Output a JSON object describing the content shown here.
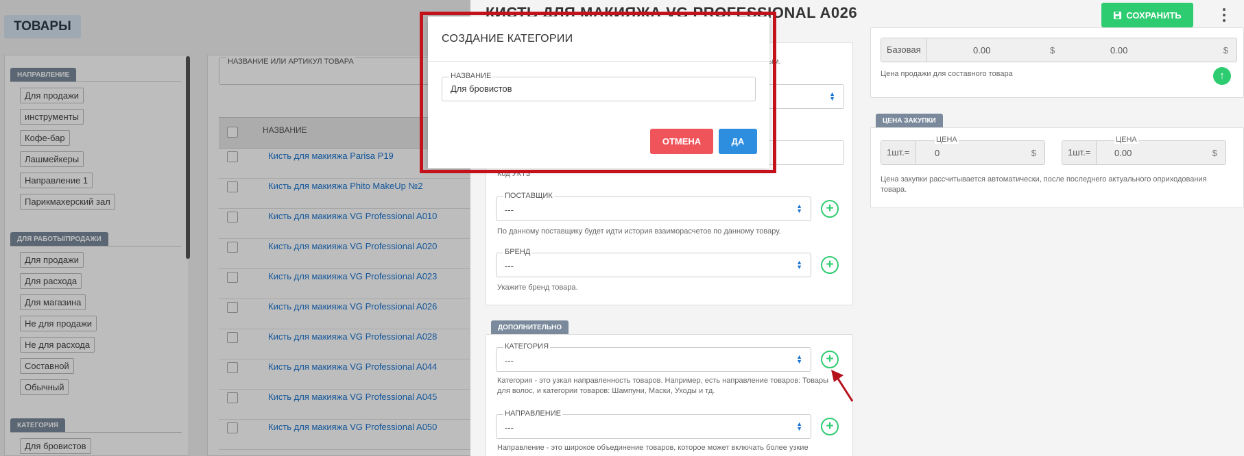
{
  "left": {
    "title": "ТОВАРЫ",
    "filters": [
      {
        "label": "НАПРАВЛЕНИЕ",
        "items": [
          "Для продажи",
          "инструменты",
          "Кофе-бар",
          "Лашмейкеры",
          "Направление 1",
          "Парикмахерский зал"
        ]
      },
      {
        "label": "ДЛЯ РАБОТЫ/ПРОДАЖИ",
        "items": [
          "Для продажи",
          "Для расхода",
          "Для магазина",
          "Не для продажи",
          "Не для расхода",
          "Составной",
          "Обычный"
        ]
      },
      {
        "label": "КАТЕГОРИЯ",
        "items": [
          "Для бровистов"
        ]
      }
    ],
    "search_label": "НАЗВАНИЕ ИЛИ АРТИКУЛ ТОВАРА",
    "col_name": "НАЗВАНИЕ",
    "rows": [
      "Кисть для макияжа Parisa P19",
      "Кисть для макияжа Phito MakeUp №2",
      "Кисть для макияжа VG Professional A010",
      "Кисть для макияжа VG Professional A020",
      "Кисть для макияжа VG Professional A023",
      "Кисть для макияжа VG Professional A026",
      "Кисть для макияжа VG Professional A028",
      "Кисть для макияжа VG Professional A044",
      "Кисть для макияжа VG Professional A045",
      "Кисть для макияжа VG Professional A050"
    ]
  },
  "panel": {
    "title": "КИСТЬ ДЛЯ МАКИЯЖА VG PROFESSIONAL A026",
    "save_label": "СОХРАНИТЬ",
    "hint_top": "тым.",
    "kod_hint": "Код УКТЗ",
    "supplier": {
      "label": "ПОСТАВЩИК",
      "value": "---",
      "hint": "По данному поставщику будет идти история взаиморасчетов по данному товару."
    },
    "brand": {
      "label": "БРЕНД",
      "value": "---",
      "hint": "Укажите бренд товара."
    },
    "extra_tag": "ДОПОЛНИТЕЛЬНО",
    "category": {
      "label": "КАТЕГОРИЯ",
      "value": "---",
      "hint_1": "Категория - это узкая направленность товаров. Например, есть направление товаров: Товары",
      "hint_2": "для волос, и категории товаров: Шампуни, Маски, Уходы и тд."
    },
    "direction": {
      "label": "НАПРАВЛЕНИЕ",
      "value": "---",
      "hint": "Направление - это широкое объединение товаров, которое может включать более узкие"
    },
    "sale": {
      "base_label": "Базовая",
      "v1": "0.00",
      "v2": "0.00",
      "currency": "$",
      "hint": "Цена продажи для составного товара"
    },
    "purchase": {
      "tag": "ЦЕНА ЗАКУПКИ",
      "unit": "1шт.=",
      "price_label": "ЦЕНА",
      "v1": "0",
      "v2": "0.00",
      "currency": "$",
      "hint_1": "Цена закупки рассчитывается автоматически, после последнего актуального оприходования",
      "hint_2": "товара."
    }
  },
  "modal": {
    "title": "СОЗДАНИЕ КАТЕГОРИИ",
    "field_label": "НАЗВАНИЕ",
    "field_value": "Для бровистов",
    "cancel_label": "ОТМЕНА",
    "ok_label": "ДА"
  },
  "colors": {
    "accent_green": "#2ecc71",
    "cancel_red": "#f0545b",
    "ok_blue": "#2d8ee0",
    "highlight": "#c4121b",
    "link": "#1a74d0"
  }
}
